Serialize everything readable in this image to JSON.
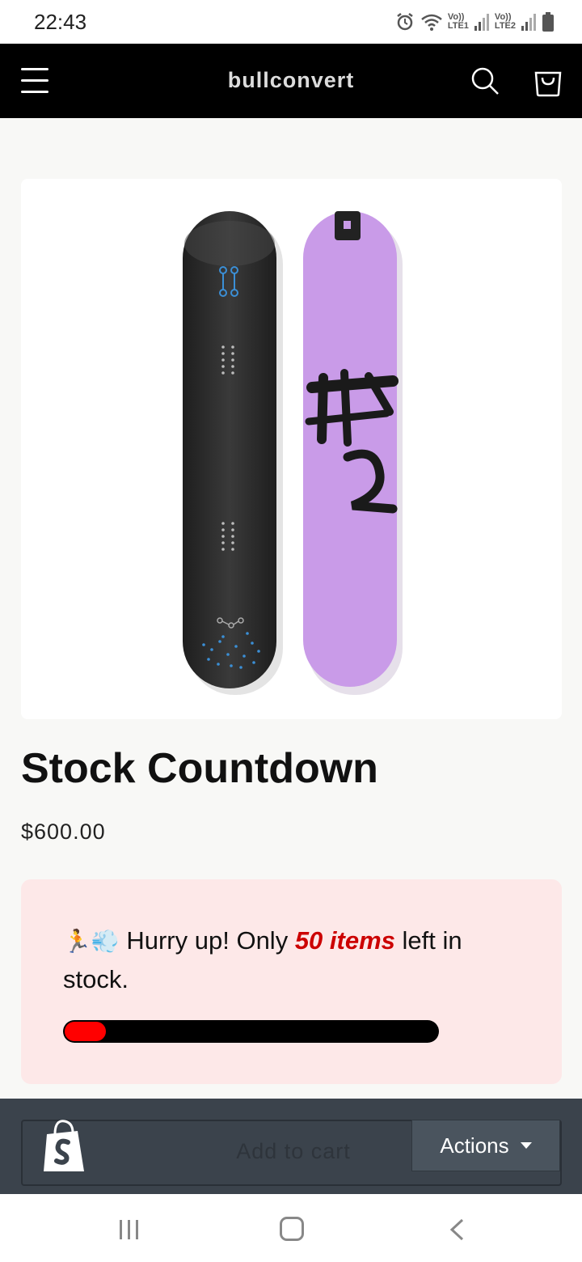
{
  "status": {
    "time": "22:43",
    "sim1": {
      "top": "Vo))",
      "bottom": "LTE1"
    },
    "sim2": {
      "top": "Vo))",
      "bottom": "LTE2"
    }
  },
  "header": {
    "brand": "bullconvert",
    "menu_icon": "hamburger-icon",
    "search_icon": "search-icon",
    "cart_icon": "cart-icon"
  },
  "product": {
    "title": "Stock Countdown",
    "price": "$600.00",
    "image_alt": "Snowboard top and base",
    "base_color": "#c99be8",
    "top_color": "#2b2b2b"
  },
  "stock_notice": {
    "emoji": "🏃💨",
    "prefix": "Hurry up! Only ",
    "count": "50 items",
    "suffix": " left in stock.",
    "progress": 0.11,
    "bar_color": "#ff0000",
    "track_color": "#000000"
  },
  "bottom_bar": {
    "add_to_cart_label": "Add to cart",
    "actions_label": "Actions",
    "logo_icon": "shopify-bag-icon"
  },
  "nav": {
    "recent_icon": "recent-apps-icon",
    "home_icon": "home-icon",
    "back_icon": "back-icon"
  }
}
